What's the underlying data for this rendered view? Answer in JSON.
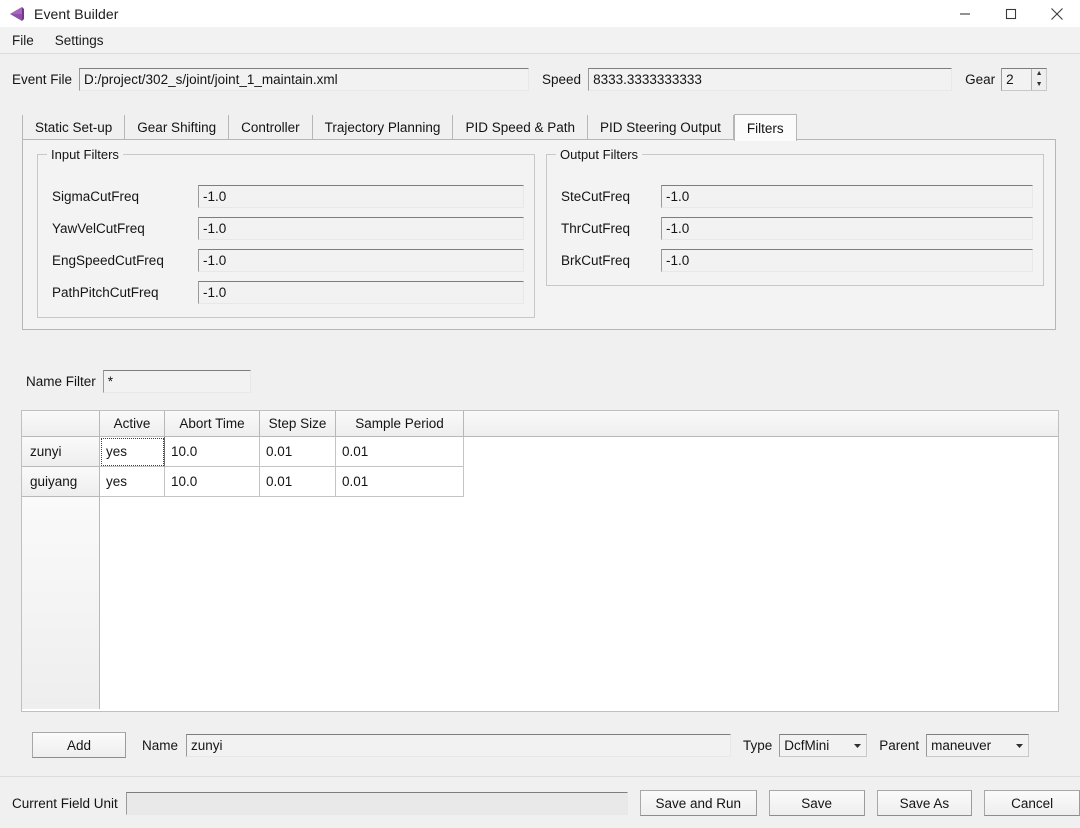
{
  "window": {
    "title": "Event Builder",
    "app_icon": "event-builder-icon",
    "accent_color": "#9b59b6",
    "controls": {
      "minimize": "minimize-icon",
      "maximize": "maximize-icon",
      "close": "close-icon"
    }
  },
  "menubar": {
    "items": [
      {
        "label": "File"
      },
      {
        "label": "Settings"
      }
    ]
  },
  "toolbar": {
    "event_file_label": "Event File",
    "event_file_value": "D:/project/302_s/joint/joint_1_maintain.xml",
    "event_file_placeholder": "",
    "speed_label": "Speed",
    "speed_value": "8333.3333333333",
    "speed_placeholder": "",
    "gear_label": "Gear",
    "gear_value": "2",
    "gear_up_icon": "spinner-up-icon",
    "gear_down_icon": "spinner-down-icon"
  },
  "tabs": {
    "selected": "Filters",
    "items": [
      {
        "label": "Static Set-up"
      },
      {
        "label": "Gear Shifting"
      },
      {
        "label": "Controller"
      },
      {
        "label": "Trajectory Planning"
      },
      {
        "label": "PID Speed & Path"
      },
      {
        "label": "PID Steering Output"
      },
      {
        "label": "Filters"
      }
    ]
  },
  "filters_tab": {
    "input_group": {
      "title": "Input Filters",
      "fields": [
        {
          "label": "SigmaCutFreq",
          "value": "-1.0"
        },
        {
          "label": "YawVelCutFreq",
          "value": "-1.0"
        },
        {
          "label": "EngSpeedCutFreq",
          "value": "-1.0"
        },
        {
          "label": "PathPitchCutFreq",
          "value": "-1.0"
        }
      ]
    },
    "output_group": {
      "title": "Output Filters",
      "fields": [
        {
          "label": "SteCutFreq",
          "value": "-1.0"
        },
        {
          "label": "ThrCutFreq",
          "value": "-1.0"
        },
        {
          "label": "BrkCutFreq",
          "value": "-1.0"
        }
      ]
    }
  },
  "name_filter": {
    "label": "Name Filter",
    "value": "*",
    "placeholder": ""
  },
  "table": {
    "columns": [
      "Active",
      "Abort Time",
      "Step Size",
      "Sample Period"
    ],
    "rows": [
      {
        "name": "zunyi",
        "cells": [
          "yes",
          "10.0",
          "0.01",
          "0.01"
        ]
      },
      {
        "name": "guiyang",
        "cells": [
          "yes",
          "10.0",
          "0.01",
          "0.01"
        ]
      }
    ],
    "focused_cell": {
      "row": 0,
      "col": 0
    }
  },
  "editrow": {
    "add_label": "Add",
    "name_label": "Name",
    "name_value": "zunyi",
    "name_placeholder": "",
    "type_label": "Type",
    "type_value": "DcfMini",
    "type_arrow_icon": "chevron-down-icon",
    "parent_label": "Parent",
    "parent_value": "maneuver",
    "parent_arrow_icon": "chevron-down-icon"
  },
  "statusbar": {
    "field_unit_label": "Current Field Unit",
    "field_unit_value": "",
    "buttons": [
      {
        "label": "Save and Run"
      },
      {
        "label": "Save"
      },
      {
        "label": "Save As"
      },
      {
        "label": "Cancel"
      }
    ]
  }
}
